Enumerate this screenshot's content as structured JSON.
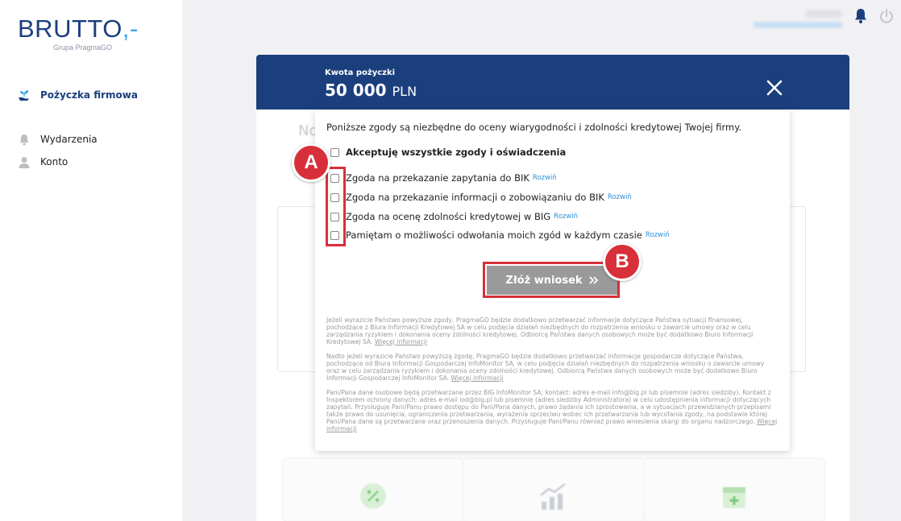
{
  "logo": {
    "brand": "BRUTTO",
    "brand_suffix": ",-",
    "subtitle": "Grupa PragmaGO"
  },
  "sidebar": {
    "items": [
      {
        "label": "Pożyczka firmowa",
        "icon": "hand-plant-icon"
      },
      {
        "label": "Wydarzenia",
        "icon": "bell-icon"
      },
      {
        "label": "Konto",
        "icon": "user-icon"
      }
    ]
  },
  "topbar": {
    "notifications_icon": "bell-icon",
    "logout_icon": "power-icon"
  },
  "background": {
    "title": "No"
  },
  "modal": {
    "loan_label": "Kwota pożyczki",
    "loan_amount": "50 000",
    "currency": "PLN",
    "intro": "Poniższe zgody są niezbędne do oceny wiarygodności i zdolności kredytowej Twojej firmy.",
    "accept_all": "Akceptuję wszystkie zgody i oświadczenia",
    "consents": [
      {
        "label": "Zgoda na przekazanie zapytania do BIK",
        "expand": "Rozwiń"
      },
      {
        "label": "Zgoda na przekazanie informacji o zobowiązaniu do BIK",
        "expand": "Rozwiń"
      },
      {
        "label": "Zgoda na ocenę zdolności kredytowej w BIG",
        "expand": "Rozwiń"
      },
      {
        "label": "Pamiętam o możliwości odwołania moich zgód w każdym czasie",
        "expand": "Rozwiń"
      }
    ],
    "submit_label": "Złóż wniosek",
    "legal": [
      {
        "text": "Jeżeli wyrazicie Państwo powyższe zgody, PragmaGO będzie dodatkowo przetwarzać informacje dotyczące Państwa sytuacji finansowej, pochodzące z Biura Informacji Kredytowej SA w celu podjęcia działań niezbędnych do rozpatrzenia wniosku o zawarcie umowy oraz w celu zarządzania ryzykiem i dokonania oceny zdolności kredytowej. Odbiorcą Państwa danych osobowych może być dodatkowo Biuro Informacji Kredytowej SA. ",
        "more": "Więcej informacji"
      },
      {
        "text": "Nadto jeżeli wyrazicie Państwo powyższą zgodę, PragmaGO będzie dodatkowo przetwarzać informacje gospodarcze dotyczące Państwa, pochodzące od Biura Informacji Gospodarczej InfoMonitor SA, w celu podjęcia działań niezbędnych do rozpatrzenia wniosku o zawarcie umowy oraz w celu zarządzania ryzykiem i dokonania oceny zdolności kredytowej. Odbiorcą Państwa danych osobowych może być dodatkowo Biuro Informacji Gospodarczej InfoMonitor SA. ",
        "more": "Więcej informacji"
      },
      {
        "text": "Pani/Pana dane osobowe będą przetwarzane przez BIG InfoMonitor SA; kontakt: adres e-mail info@big.pl lub pisemnie (adres siedziby). Kontakt z Inspektorem ochrony danych: adres e-mail iod@big.pl lub pisemnie (adres siedziby Administratora) w celu udostępnienia informacji dotyczących zapytań. Przysługuje Pani/Panu prawo dostępu do Pani/Pana danych, prawo żądania ich sprostowania, a w sytuacjach przewidzianych przepisami także prawo do usunięcia, ograniczenia przetwarzania, wyrażenia sprzeciwu wobec ich przetwarzania lub wycofania zgody, na podstawie której Pani/Pana dane są przetwarzane oraz przenoszenia danych. Przysługuje Pani/Panu również prawo wniesienia skargi do organu nadzorczego. ",
        "more": "Więcej informacji"
      }
    ]
  },
  "annotations": [
    {
      "label": "A"
    },
    {
      "label": "B"
    }
  ],
  "colors": {
    "navy": "#1b3f7d",
    "accent": "#39a6e3",
    "annotation_red": "#d8303a",
    "button_gray": "#9a9a9c"
  }
}
